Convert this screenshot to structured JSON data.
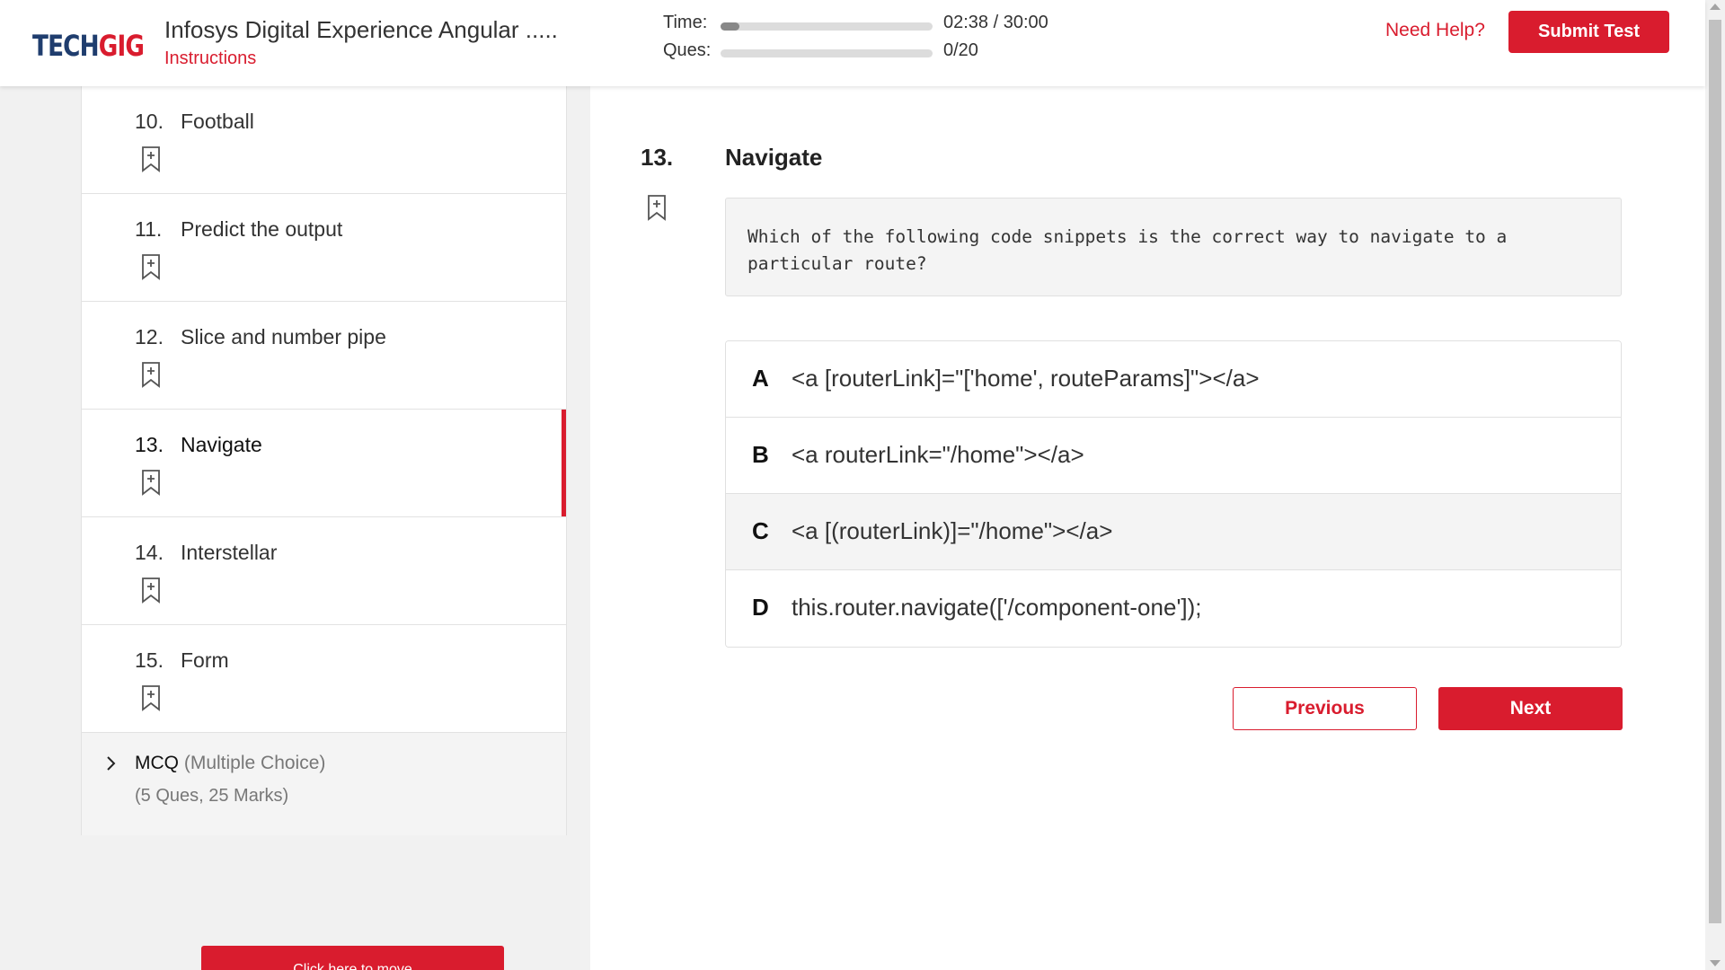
{
  "header": {
    "logo_part1": "TECH",
    "logo_part2": "GIG",
    "test_title": "Infosys Digital Experience Angular .....",
    "instructions_label": "Instructions",
    "time_label": "Time:",
    "time_value": "02:38 / 30:00",
    "time_progress": 0.088,
    "ques_label": "Ques:",
    "ques_value": "0/20",
    "ques_progress": 0,
    "need_help_label": "Need Help?",
    "submit_label": "Submit Test"
  },
  "sidebar": {
    "questions": [
      {
        "number": "10.",
        "title": "Football",
        "active": false
      },
      {
        "number": "11.",
        "title": "Predict the output",
        "active": false
      },
      {
        "number": "12.",
        "title": "Slice and number pipe",
        "active": false
      },
      {
        "number": "13.",
        "title": "Navigate",
        "active": true
      },
      {
        "number": "14.",
        "title": "Interstellar",
        "active": false
      },
      {
        "number": "15.",
        "title": "Form",
        "active": false
      }
    ],
    "section": {
      "name": "MCQ",
      "type": "(Multiple Choice)",
      "details": "(5 Ques, 25 Marks)"
    },
    "move_button_label": "Click here to move"
  },
  "question": {
    "number": "13.",
    "title": "Navigate",
    "text": "Which of the following code snippets is the correct way to navigate to a particular route?",
    "options": [
      {
        "letter": "A",
        "text": "<a [routerLink]=\"['home', routeParams]\"></a>"
      },
      {
        "letter": "B",
        "text": "<a routerLink=\"/home\"></a>"
      },
      {
        "letter": "C",
        "text": "<a [(routerLink)]=\"/home\"></a>"
      },
      {
        "letter": "D",
        "text": "this.router.navigate(['/component-one']);"
      }
    ],
    "hovered_option": "C"
  },
  "navigation": {
    "previous_label": "Previous",
    "next_label": "Next"
  },
  "colors": {
    "brand_red": "#d91c2e",
    "brand_navy": "#1f3d6e"
  }
}
